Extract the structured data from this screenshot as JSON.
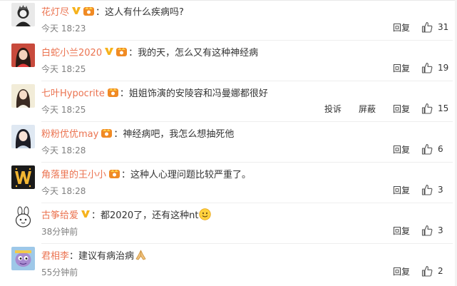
{
  "comments": [
    {
      "user": "花灯尽",
      "text": "这人有什么疾病吗?",
      "time": "今天 18:23",
      "reply": "回复",
      "likes": "31",
      "badges": [
        "v",
        "yellow"
      ]
    },
    {
      "user": "白蛇小兰2020",
      "text": "我的天，怎么又有这种神经病",
      "time": "今天 18:25",
      "reply": "回复",
      "likes": "19",
      "badges": [
        "v",
        "yellow"
      ]
    },
    {
      "user": "七叶Hypocrite",
      "text": "姐姐饰演的安陵容和冯曼娜都很好",
      "time": "今天 18:25",
      "report": "投诉",
      "block": "屏蔽",
      "reply": "回复",
      "likes": "15",
      "badges": [
        "yellow"
      ]
    },
    {
      "user": "粉粉优优may",
      "text": "神经病吧，我怎么想抽死他",
      "time": "今天 18:28",
      "reply": "回复",
      "likes": "6",
      "badges": [
        "yellow"
      ]
    },
    {
      "user": "角落里的王小小",
      "text": "这种人心理问题比较严重了。",
      "time": "今天 18:28",
      "reply": "回复",
      "likes": "3",
      "badges": [
        "yellow"
      ]
    },
    {
      "user": "古筝给爱",
      "text": "都2020了，还有这种nt",
      "time": "38分钟前",
      "reply": "回复",
      "likes": "3",
      "badges": [
        "v"
      ],
      "emoji": "smile-emoji"
    },
    {
      "user": "君相李",
      "text": "建议有病治病",
      "time": "55分钟前",
      "reply": "回复",
      "likes": "2",
      "badges": [],
      "emoji": "pray-emoji"
    }
  ],
  "colors": {
    "username": "#eb7350",
    "text": "#333333",
    "time": "#808080",
    "vbadge": "#f6b21c"
  }
}
